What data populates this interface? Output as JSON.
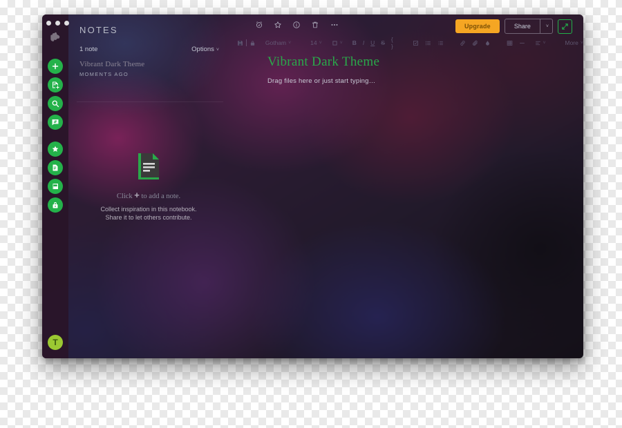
{
  "app": {
    "name": "Evernote",
    "logo_icon": "evernote-elephant-icon",
    "theme_accent": "#24b24a",
    "upgrade_color": "#f5a623",
    "title_color": "#2aa84a"
  },
  "window_controls": {
    "close": "close-button",
    "minimize": "minimize-button",
    "maximize": "maximize-button"
  },
  "rail": {
    "primary": [
      {
        "icon": "plus-icon",
        "name": "new-note-button"
      },
      {
        "icon": "note-plus-icon",
        "name": "new-note-from-template-button"
      },
      {
        "icon": "search-icon",
        "name": "search-button"
      },
      {
        "icon": "sync-icon",
        "name": "sync-button"
      }
    ],
    "secondary": [
      {
        "icon": "star-icon",
        "name": "shortcuts-button"
      },
      {
        "icon": "notes-icon",
        "name": "notes-button"
      },
      {
        "icon": "notebook-icon",
        "name": "notebooks-button"
      },
      {
        "icon": "tag-icon",
        "name": "tags-button"
      }
    ],
    "avatar": {
      "icon": "user-avatar",
      "initial": "T"
    }
  },
  "note_list": {
    "header": "NOTES",
    "count_label": "1 note",
    "options_label": "Options",
    "options_caret": "˅",
    "notes": [
      {
        "title": "Vibrant Dark Theme",
        "date": "MOMENTS AGO"
      }
    ],
    "empty_state": {
      "icon": "note-document-icon",
      "headline_before": "Click ",
      "headline_plus": "+",
      "headline_after": " to add a note.",
      "line1": "Collect inspiration in this notebook.",
      "line2": "Share it to let others contribute."
    }
  },
  "toolbar": {
    "actions": [
      {
        "icon": "reminder-alarm-icon",
        "name": "reminder-button"
      },
      {
        "icon": "star-icon",
        "name": "favorite-button"
      },
      {
        "icon": "info-icon",
        "name": "note-info-button"
      },
      {
        "icon": "trash-icon",
        "name": "delete-note-button"
      },
      {
        "icon": "ellipsis-icon",
        "name": "more-actions-button"
      }
    ],
    "upgrade_label": "Upgrade",
    "share_label": "Share",
    "share_caret": "˅",
    "expand_icon": "expand-arrows-icon"
  },
  "format_bar": {
    "save_icon": "save-icon",
    "lock_icon": "lock-icon",
    "font_family": "Gotham",
    "font_size": "14",
    "caret": "˅",
    "color_icon": "text-color-icon",
    "bold": "B",
    "italic": "I",
    "underline": "U",
    "strikethrough": "S",
    "code": "{ }",
    "checklist_icon": "checklist-icon",
    "bullet_list_icon": "bullet-list-icon",
    "numbered_list_icon": "numbered-list-icon",
    "link_icon": "link-icon",
    "attachment_icon": "attachment-icon",
    "highlight_icon": "highlight-icon",
    "table_icon": "table-icon",
    "rule_icon": "horizontal-rule-icon",
    "align_icon": "align-icon",
    "more_label": "More"
  },
  "document": {
    "title": "Vibrant Dark Theme",
    "placeholder": "Drag files here or just start typing…"
  }
}
